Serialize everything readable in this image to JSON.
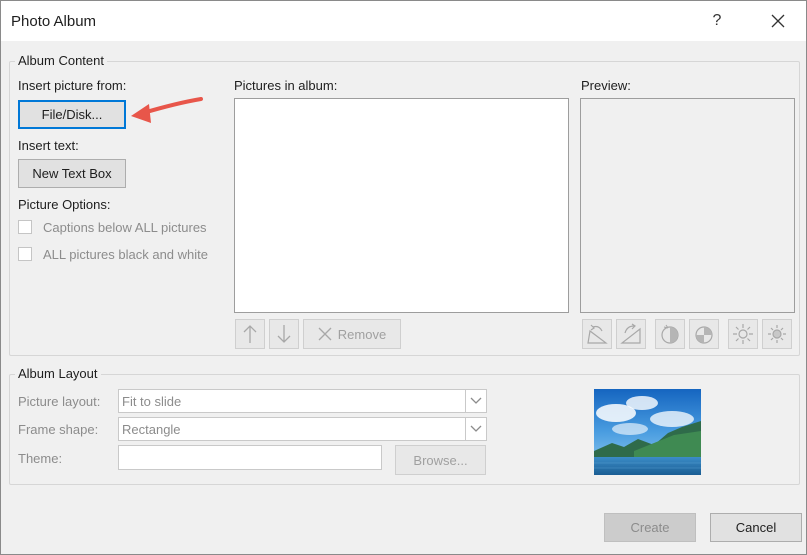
{
  "window": {
    "title": "Photo Album",
    "help_label": "?"
  },
  "album_content": {
    "legend": "Album Content",
    "insert_picture_from": "Insert picture from:",
    "file_disk_button": "File/Disk...",
    "insert_text": "Insert text:",
    "new_text_box_button": "New Text Box",
    "picture_options": "Picture Options:",
    "captions_checkbox": "Captions below ALL pictures",
    "black_white_checkbox": "ALL pictures black and white",
    "pictures_in_album": "Pictures in album:",
    "remove_button": "Remove",
    "preview": "Preview:"
  },
  "album_layout": {
    "legend": "Album Layout",
    "picture_layout_label": "Picture layout:",
    "picture_layout_value": "Fit to slide",
    "frame_shape_label": "Frame shape:",
    "frame_shape_value": "Rectangle",
    "theme_label": "Theme:",
    "theme_value": "",
    "browse_button": "Browse..."
  },
  "footer": {
    "create_button": "Create",
    "cancel_button": "Cancel"
  },
  "colors": {
    "annotation_arrow": "#e8564a",
    "focus_border": "#0078d7"
  }
}
